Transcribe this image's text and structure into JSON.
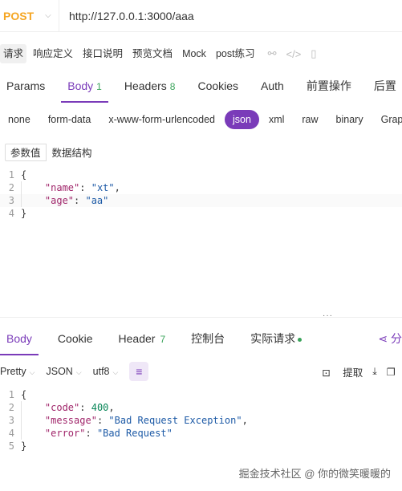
{
  "request": {
    "method": "POST",
    "url": "http://127.0.0.1:3000/aaa"
  },
  "subtabs": [
    "请求",
    "响应定义",
    "接口说明",
    "预览文档",
    "Mock",
    "post练习"
  ],
  "req_tabs": [
    {
      "label": "Params",
      "count": ""
    },
    {
      "label": "Body",
      "count": "1"
    },
    {
      "label": "Headers",
      "count": "8"
    },
    {
      "label": "Cookies",
      "count": ""
    },
    {
      "label": "Auth",
      "count": ""
    },
    {
      "label": "前置操作",
      "count": ""
    },
    {
      "label": "后置",
      "count": ""
    }
  ],
  "body_types": [
    "none",
    "form-data",
    "x-www-form-urlencoded",
    "json",
    "xml",
    "raw",
    "binary",
    "GraphQL"
  ],
  "param_tabs": [
    "参数值",
    "数据结构"
  ],
  "request_body": {
    "line_numbers": [
      "1",
      "2",
      "3",
      "4"
    ],
    "open": "{",
    "close": "}",
    "fields": [
      {
        "key": "\"name\"",
        "value": "\"xt\""
      },
      {
        "key": "\"age\"",
        "value": "\"aa\""
      }
    ]
  },
  "resp_tabs": [
    {
      "label": "Body",
      "count": ""
    },
    {
      "label": "Cookie",
      "count": ""
    },
    {
      "label": "Header",
      "count": "7"
    },
    {
      "label": "控制台",
      "count": ""
    },
    {
      "label": "实际请求",
      "count": ""
    }
  ],
  "share_label": "分",
  "resp_toolbar": {
    "format": "Pretty",
    "language": "JSON",
    "encoding": "utf8",
    "extract": "提取"
  },
  "response_body": {
    "line_numbers": [
      "1",
      "2",
      "3",
      "4",
      "5"
    ],
    "open": "{",
    "close": "}",
    "fields": [
      {
        "key": "\"code\"",
        "value": "400",
        "type": "num"
      },
      {
        "key": "\"message\"",
        "value": "\"Bad Request Exception\"",
        "type": "str"
      },
      {
        "key": "\"error\"",
        "value": "\"Bad Request\"",
        "type": "str"
      }
    ]
  },
  "watermark": "掘金技术社区 @ 你的微笑暖暖的",
  "colors": {
    "accent": "#7a3bb9",
    "method": "#f5a623",
    "count_green": "#3aa35a"
  }
}
